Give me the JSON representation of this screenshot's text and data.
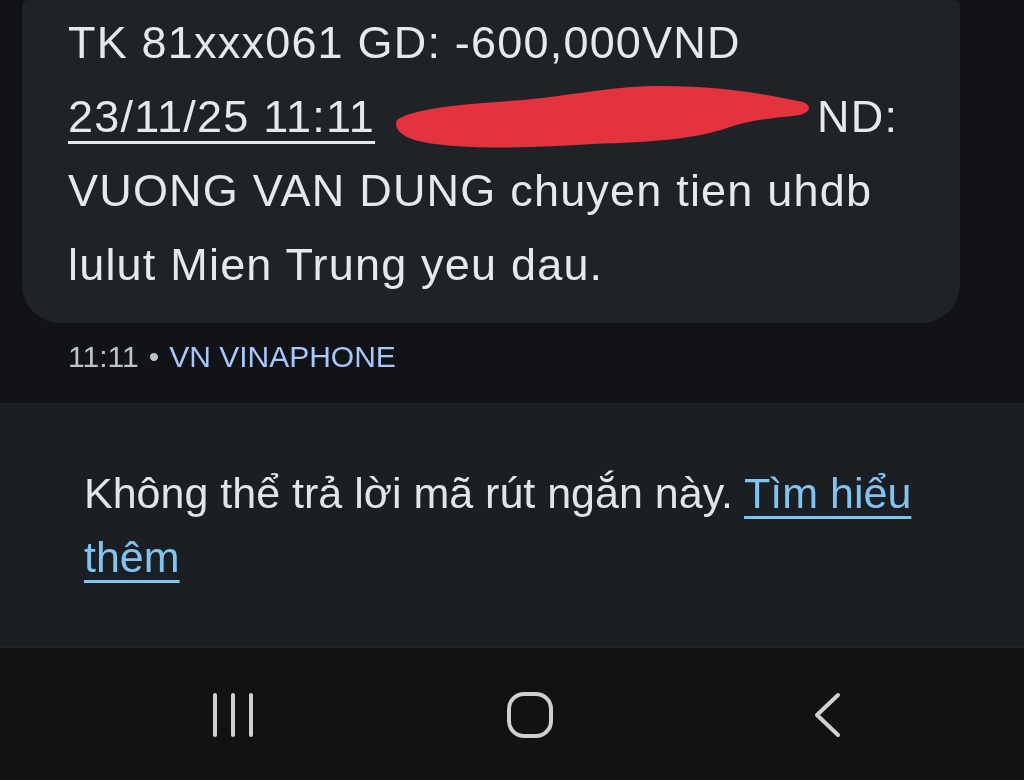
{
  "message": {
    "line_1": "TK 81xxx061 GD: -600,000VND",
    "line_2": [
      {
        "kind": "link",
        "text": "23/11/25 11:11"
      },
      {
        "kind": "redaction"
      },
      {
        "kind": "text",
        "text": "ND:"
      }
    ],
    "body": "VUONG VAN DUNG chuyen tien uhdb lulut Mien Trung yeu dau."
  },
  "message_meta": {
    "time": "11:11",
    "separator": "•",
    "sim": "VN VINAPHONE"
  },
  "reply_notice": {
    "text": "Không thể trả lời mã rút ngắn này.",
    "link_parts": [
      "Tìm hiểu",
      "thêm"
    ]
  },
  "nav_bar": {
    "buttons": [
      {
        "kind": "recents"
      },
      {
        "kind": "home"
      },
      {
        "kind": "back"
      }
    ]
  }
}
